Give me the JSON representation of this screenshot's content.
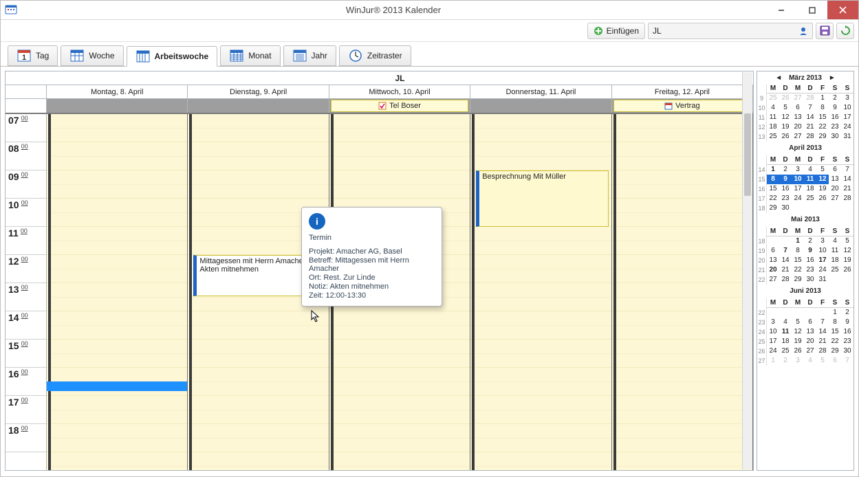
{
  "title": "WinJur® 2013 Kalender",
  "einfuegen": "Einfügen",
  "user_short": "JL",
  "tabs": {
    "tag": "Tag",
    "woche": "Woche",
    "arbeitswoche": "Arbeitswoche",
    "monat": "Monat",
    "jahr": "Jahr",
    "zeitraster": "Zeitraster"
  },
  "header": {
    "owner": "JL",
    "days": [
      "Montag, 8. April",
      "Dienstag, 9. April",
      "Mittwoch, 10. April",
      "Donnerstag, 11. April",
      "Freitag, 12. April"
    ]
  },
  "allday": {
    "mi": "Tel Boser",
    "fr": "Vertrag"
  },
  "hours": [
    "07",
    "08",
    "09",
    "10",
    "11",
    "12",
    "13",
    "14",
    "15",
    "16",
    "17",
    "18"
  ],
  "minute": "00",
  "events": {
    "amacher": {
      "line1": "Mittagessen mit Herrn Amacher (Rest. Zur Linde)",
      "line2": "Akten mitnehmen"
    },
    "mueller": "Besprechnung Mit Müller"
  },
  "tooltip": {
    "title": "Termin",
    "l1": "Projekt: Amacher AG, Basel",
    "l2": "Betreff: Mittagessen mit Herrn Amacher",
    "l3": "Ort: Rest. Zur Linde",
    "l4": "Notiz: Akten mitnehmen",
    "l5": "Zeit: 12:00-13:30"
  },
  "mini": {
    "nav_title": "März 2013",
    "maerz": {
      "title": "März 2013",
      "dow": [
        "M",
        "D",
        "M",
        "D",
        "F",
        "S",
        "S"
      ],
      "rows": [
        {
          "wk": "9",
          "d": [
            "25",
            "26",
            "27",
            "28",
            "1",
            "2",
            "3"
          ],
          "dim": [
            0,
            1,
            2,
            3
          ]
        },
        {
          "wk": "10",
          "d": [
            "4",
            "5",
            "6",
            "7",
            "8",
            "9",
            "10"
          ]
        },
        {
          "wk": "11",
          "d": [
            "11",
            "12",
            "13",
            "14",
            "15",
            "16",
            "17"
          ]
        },
        {
          "wk": "12",
          "d": [
            "18",
            "19",
            "20",
            "21",
            "22",
            "23",
            "24"
          ]
        },
        {
          "wk": "13",
          "d": [
            "25",
            "26",
            "27",
            "28",
            "29",
            "30",
            "31"
          ]
        }
      ]
    },
    "april": {
      "title": "April 2013",
      "dow": [
        "M",
        "D",
        "M",
        "D",
        "F",
        "S",
        "S"
      ],
      "rows": [
        {
          "wk": "14",
          "d": [
            "1",
            "2",
            "3",
            "4",
            "5",
            "6",
            "7"
          ],
          "bold": [
            0
          ]
        },
        {
          "wk": "15",
          "d": [
            "8",
            "9",
            "10",
            "11",
            "12",
            "13",
            "14"
          ],
          "sel": [
            0,
            1,
            2,
            3,
            4
          ],
          "today": 0
        },
        {
          "wk": "16",
          "d": [
            "15",
            "16",
            "17",
            "18",
            "19",
            "20",
            "21"
          ]
        },
        {
          "wk": "17",
          "d": [
            "22",
            "23",
            "24",
            "25",
            "26",
            "27",
            "28"
          ]
        },
        {
          "wk": "18",
          "d": [
            "29",
            "30"
          ]
        }
      ]
    },
    "mai": {
      "title": "Mai 2013",
      "dow": [
        "M",
        "D",
        "M",
        "D",
        "F",
        "S",
        "S"
      ],
      "rows": [
        {
          "wk": "18",
          "d": [
            "",
            "",
            "1",
            "2",
            "3",
            "4",
            "5"
          ],
          "bold": [
            2
          ]
        },
        {
          "wk": "19",
          "d": [
            "6",
            "7",
            "8",
            "9",
            "10",
            "11",
            "12"
          ],
          "bold": [
            1,
            3
          ]
        },
        {
          "wk": "20",
          "d": [
            "13",
            "14",
            "15",
            "16",
            "17",
            "18",
            "19"
          ],
          "bold": [
            4
          ]
        },
        {
          "wk": "21",
          "d": [
            "20",
            "21",
            "22",
            "23",
            "24",
            "25",
            "26"
          ],
          "bold": [
            0
          ]
        },
        {
          "wk": "22",
          "d": [
            "27",
            "28",
            "29",
            "30",
            "31"
          ]
        }
      ]
    },
    "juni": {
      "title": "Juni 2013",
      "dow": [
        "M",
        "D",
        "M",
        "D",
        "F",
        "S",
        "S"
      ],
      "rows": [
        {
          "wk": "22",
          "d": [
            "",
            "",
            "",
            "",
            "",
            "1",
            "2"
          ]
        },
        {
          "wk": "23",
          "d": [
            "3",
            "4",
            "5",
            "6",
            "7",
            "8",
            "9"
          ]
        },
        {
          "wk": "24",
          "d": [
            "10",
            "11",
            "12",
            "13",
            "14",
            "15",
            "16"
          ],
          "bold": [
            1
          ]
        },
        {
          "wk": "25",
          "d": [
            "17",
            "18",
            "19",
            "20",
            "21",
            "22",
            "23"
          ]
        },
        {
          "wk": "26",
          "d": [
            "24",
            "25",
            "26",
            "27",
            "28",
            "29",
            "30"
          ]
        },
        {
          "wk": "27",
          "d": [
            "1",
            "2",
            "3",
            "4",
            "5",
            "6",
            "7"
          ],
          "dim": [
            0,
            1,
            2,
            3,
            4,
            5,
            6
          ]
        }
      ]
    }
  }
}
